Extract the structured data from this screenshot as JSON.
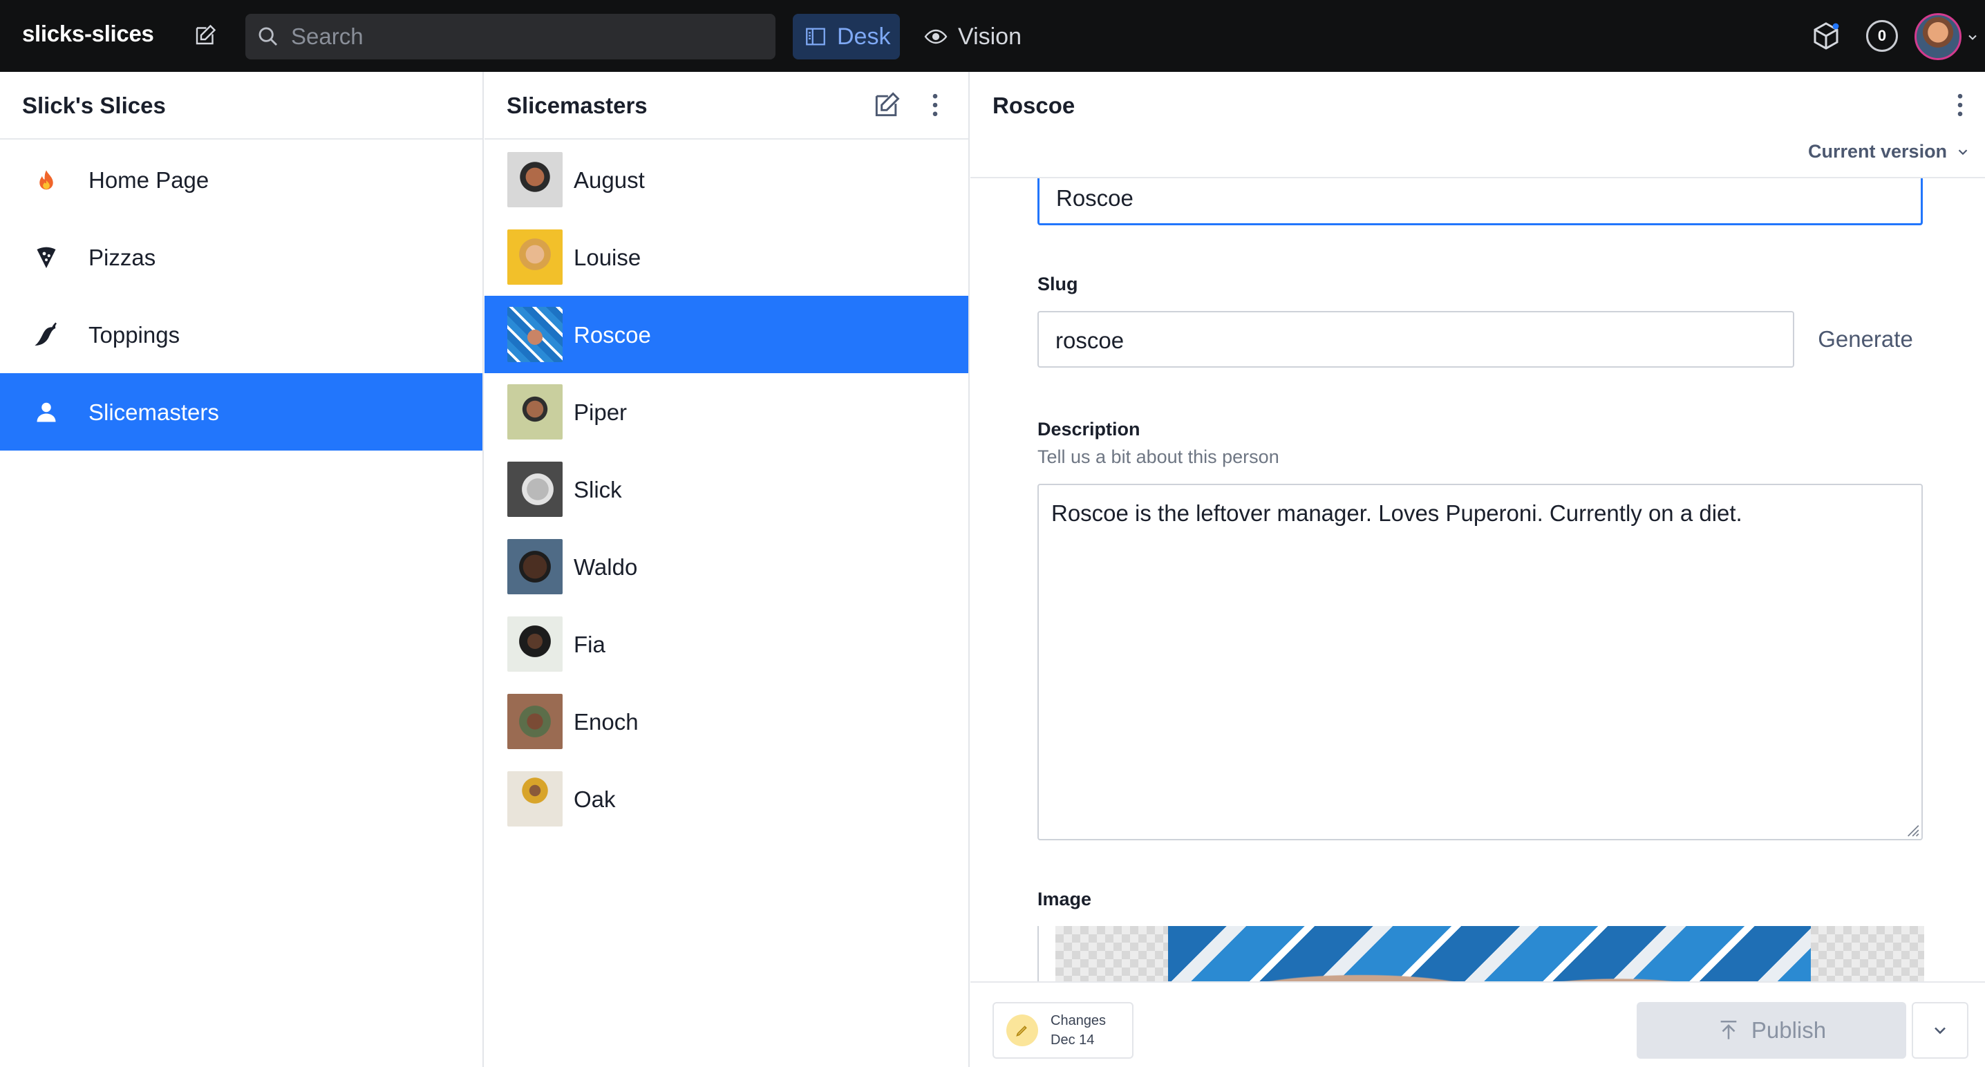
{
  "app": {
    "title": "slicks-slices",
    "search_placeholder": "Search",
    "tools": [
      {
        "label": "Desk",
        "icon": "desk-icon",
        "active": true
      },
      {
        "label": "Vision",
        "icon": "eye-icon",
        "active": false
      }
    ],
    "notification_count": "0"
  },
  "structure": {
    "title": "Slick's Slices",
    "items": [
      {
        "label": "Home Page",
        "icon": "fire-icon"
      },
      {
        "label": "Pizzas",
        "icon": "pizza-icon"
      },
      {
        "label": "Toppings",
        "icon": "pepper-icon"
      },
      {
        "label": "Slicemasters",
        "icon": "user-icon",
        "selected": true
      }
    ]
  },
  "slicemasters": {
    "title": "Slicemasters",
    "people": [
      {
        "name": "August"
      },
      {
        "name": "Louise"
      },
      {
        "name": "Roscoe",
        "selected": true
      },
      {
        "name": "Piper"
      },
      {
        "name": "Slick"
      },
      {
        "name": "Waldo"
      },
      {
        "name": "Fia"
      },
      {
        "name": "Enoch"
      },
      {
        "name": "Oak"
      }
    ]
  },
  "editor": {
    "title": "Roscoe",
    "version_label": "Current version",
    "name_value": "Roscoe",
    "slug": {
      "label": "Slug",
      "value": "roscoe",
      "generate_label": "Generate"
    },
    "description": {
      "label": "Description",
      "hint": "Tell us a bit about this person",
      "value": "Roscoe is the leftover manager. Loves Puperoni. Currently on a diet."
    },
    "image": {
      "label": "Image"
    }
  },
  "footer": {
    "changes_title": "Changes",
    "changes_date": "Dec 14",
    "publish_label": "Publish"
  },
  "colors": {
    "accent": "#2276fc",
    "navbar": "#101112",
    "desk_active_bg": "#1d3458"
  }
}
